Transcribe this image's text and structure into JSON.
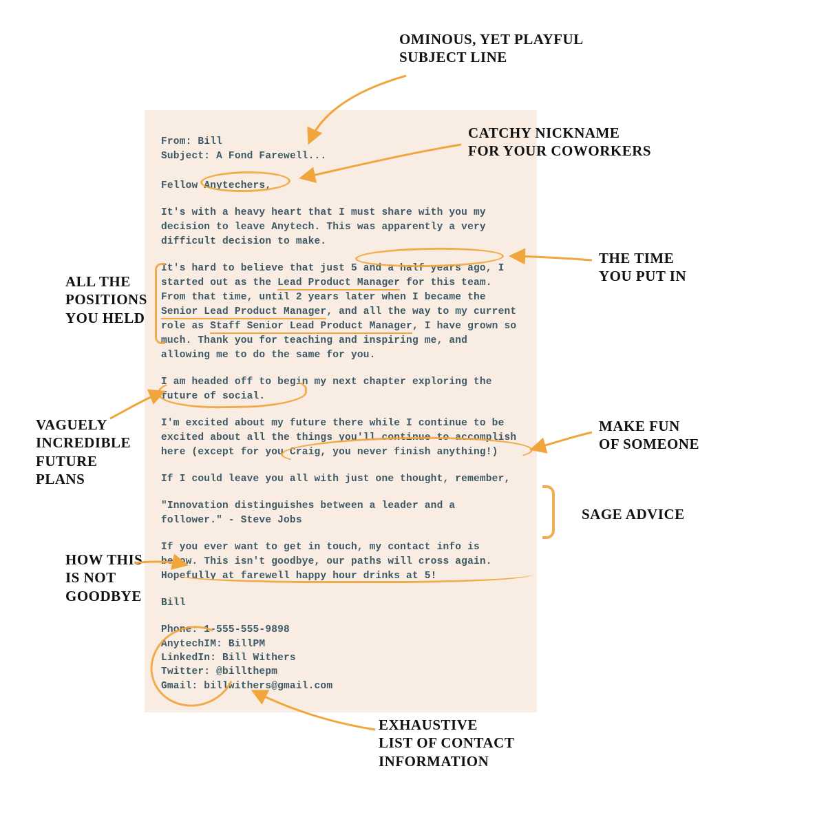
{
  "email": {
    "from_label": "From: ",
    "from_value": "Bill",
    "subject_label": "Subject: ",
    "subject_value": "A Fond Farewell...",
    "greeting_pre": "Fellow ",
    "greeting_nick": "Anytechers",
    "greeting_post": ",",
    "p1": "It's with a heavy heart that I must share with you my decision to leave Anytech. This was apparently a very difficult decision to make.",
    "p2_a": "It's hard to believe that just 5 and a half years ago, I started out as the ",
    "p2_role1": "Lead Product Manager",
    "p2_b": " for this team. From that time, until 2 years later when I became the ",
    "p2_role2": "Senior Lead Product Manager",
    "p2_c": ", and all the way to my current role as ",
    "p2_role3": "Staff Senior Lead Product Manager",
    "p2_d": ", I have grown so much. Thank you for teaching and inspiring me, and allowing me to do the same for you.",
    "p3": "I am headed off to begin my next chapter exploring the future of social.",
    "p4": "I'm excited about my future there while I continue to be excited about all the things you'll continue to accom­plish here (except for you Craig, you never finish anything!)",
    "p5": "If I could leave you all with just one thought, remember,",
    "quote": "\"Innovation distinguishes between a leader and a follower.\" - Steve Jobs",
    "p6_a": "If you ever want to get in touch, my contact info is below. ",
    "p6_b": "This isn't goodbye, our paths will cross again.",
    "p6_c": " Hopefully at farewell happy hour drinks at 5!",
    "signoff": "Bill",
    "contacts": {
      "phone": "Phone: 1-555-555-9898",
      "im": "AnytechIM: BillPM",
      "linkedin": "LinkedIn: Bill Withers",
      "twitter": "Twitter: @billthepm",
      "gmail": "Gmail: billwithers@gmail.com"
    }
  },
  "annotations": {
    "subject": "OMINOUS, YET PLAYFUL\nSUBJECT LINE",
    "nickname": "CATCHY NICKNAME\nFOR YOUR COWORKERS",
    "tenure": "THE TIME\nYOU PUT IN",
    "positions": "ALL THE\nPOSITIONS\nYOU HELD",
    "plans": "VAGUELY\nINCREDIBLE\nFUTURE\nPLANS",
    "mock": "MAKE FUN\nOF SOMEONE",
    "advice": "SAGE ADVICE",
    "notgoodbye": "HOW THIS\nIS NOT\nGOODBYE",
    "contacts": "EXHAUSTIVE\nLIST OF CONTACT\nINFORMATION"
  },
  "colors": {
    "highlight": "#f0a63c",
    "cardbg": "#f9ede3",
    "email_text": "#3b5864",
    "anno_text": "#111111"
  }
}
